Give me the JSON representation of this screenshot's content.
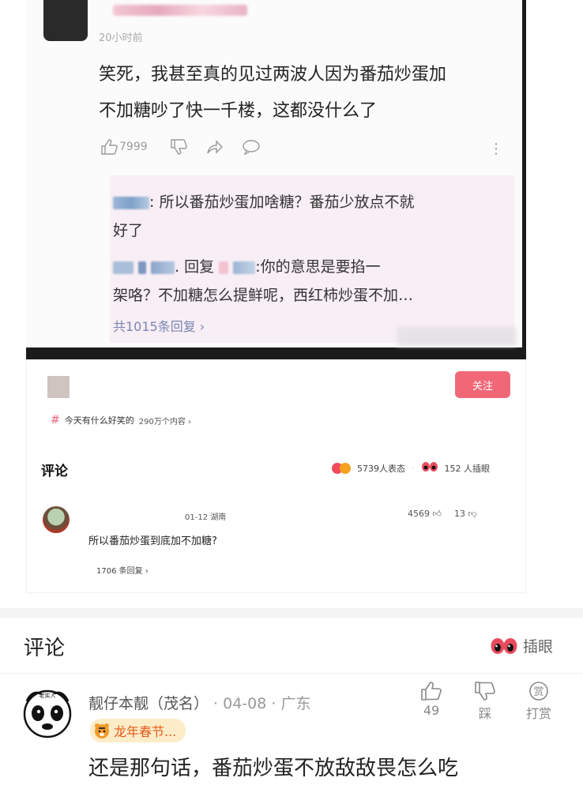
{
  "embedded_post": {
    "time": "20小时前",
    "text_line1": "笑死，我甚至真的见过两波人因为番茄炒蛋加",
    "text_line2": "不加糖吵了快一千楼，这都没什么了",
    "like_count": "7999",
    "reply1_line1": ": 所以番茄炒蛋加啥糖？番茄少放点不就",
    "reply1_line2": "好了",
    "reply2_part1": ". 回复",
    "reply2_part2": ":你的意思是要掐一",
    "reply2_line2": "架咯？不加糖怎么提鲜呢，西红柿炒蛋不加…",
    "reply_count": "共1015条回复 ›"
  },
  "second_post": {
    "follow_label": "关注",
    "topic_label": "今天有什么好笑的",
    "topic_count": "290万个内容 ›",
    "comment_title": "评论",
    "reactions": "5739人表态",
    "peeks": "152 人插眼",
    "comment_meta": "01-12 湖南",
    "comment_likes": "4569",
    "comment_dislikes": "13",
    "comment_text": "所以番茄炒蛋到底加不加糖?",
    "comment_replies": "1706 条回复 ›"
  },
  "comments": {
    "title": "评论",
    "peek_label": "插眼",
    "avatar_text": "老实人",
    "user_name": "靓仔本靓（茂名）",
    "user_meta": " · 04-08 · 广东",
    "badge_label": "龙年春节...",
    "like_count": "49",
    "dislike_label": "踩",
    "reward_label": "打赏",
    "reward_icon_char": "赏",
    "text": "还是那句话，番茄炒蛋不放敌敌畏怎么吃"
  }
}
